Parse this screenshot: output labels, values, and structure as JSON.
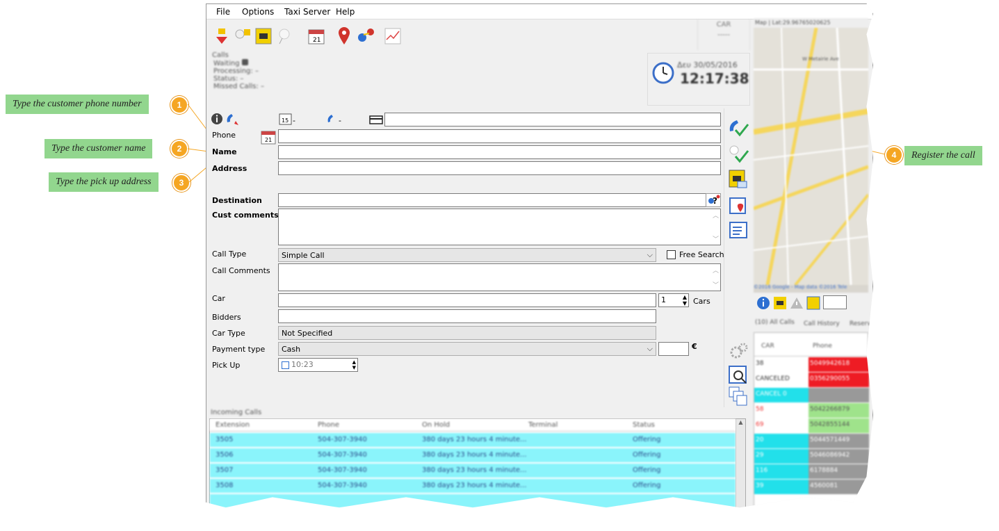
{
  "menu": {
    "file": "File",
    "options": "Options",
    "taxi_server": "Taxi Server",
    "help": "Help"
  },
  "calls_panel": {
    "title": "Calls",
    "waiting": "Waiting",
    "processing": "Processing:",
    "status": "Status:",
    "missed": "Missed Calls:"
  },
  "car_box": {
    "label": "CAR",
    "value": "-----"
  },
  "clock": {
    "date": "Δευ 30/05/2016",
    "time": "12:17:38"
  },
  "quick_row": {
    "date_dash": "-",
    "phone_dash": "-"
  },
  "form": {
    "phone": "Phone",
    "name": "Name",
    "address": "Address",
    "destination": "Destination",
    "cust_comments": "Cust comments",
    "call_type": "Call Type",
    "call_type_value": "Simple Call",
    "free_search": "Free Search",
    "call_comments": "Call Comments",
    "car": "Car",
    "car_count": "1",
    "cars": "Cars",
    "bidders": "Bidders",
    "car_type": "Car Type",
    "car_type_value": "Not Specified",
    "payment_type": "Payment type",
    "payment_value": "Cash",
    "currency": "€",
    "pick_up": "Pick Up",
    "pick_up_time": "10:23",
    "calendar_day": "21",
    "date_day": "15"
  },
  "incoming": {
    "title": "Incoming Calls",
    "columns": [
      "Extension",
      "Phone",
      "On Hold",
      "Terminal",
      "Status"
    ],
    "rows": [
      [
        "3505",
        "504-307-3940",
        "380 days 23 hours 4 minute...",
        "",
        "Offering"
      ],
      [
        "3506",
        "504-307-3940",
        "380 days 23 hours 4 minute...",
        "",
        "Offering"
      ],
      [
        "3507",
        "504-307-3940",
        "380 days 23 hours 4 minute...",
        "",
        "Offering"
      ],
      [
        "3508",
        "504-307-3940",
        "380 days 23 hours 4 minute...",
        "",
        "Offering"
      ]
    ]
  },
  "map": {
    "header": "Map | Lat:29.96765020625",
    "street": "W Metairie Ave",
    "footer": "©2016 Google - Map data ©2016 Tele"
  },
  "right_tabs": {
    "all_calls": "(10) All Calls",
    "history": "Call History",
    "reserv": "Reserv"
  },
  "right_grid": {
    "columns": [
      "CAR",
      "Phone"
    ],
    "rows": [
      {
        "car": "38",
        "phone": "5049942618",
        "color": "#ee1c24"
      },
      {
        "car": "CANCELED",
        "phone": "0356290055",
        "color": "#ee1c24"
      },
      {
        "car": "CANCEL 0",
        "phone": "",
        "color": "#22e0ea"
      },
      {
        "car": "58",
        "phone": "5042266879",
        "color": "#9fe38b"
      },
      {
        "car": "69",
        "phone": "5042855144",
        "color": "#9fe38b"
      },
      {
        "car": "20",
        "phone": "5044571449",
        "color": "#22e0ea"
      },
      {
        "car": "29",
        "phone": "5046086942",
        "color": "#22e0ea"
      },
      {
        "car": "116",
        "phone": "6178884",
        "color": "#22e0ea"
      },
      {
        "car": "39",
        "phone": "4560081",
        "color": "#22e0ea"
      }
    ]
  },
  "annotations": [
    {
      "num": "1",
      "text": "Type the customer phone number"
    },
    {
      "num": "2",
      "text": "Type the customer name"
    },
    {
      "num": "3",
      "text": "Type the pick up address"
    },
    {
      "num": "4",
      "text": "Register the call"
    }
  ],
  "colors": {
    "annotation_bg": "#92d68e",
    "annotation_num": "#f5a623",
    "grid_row": "#8af4fb"
  }
}
